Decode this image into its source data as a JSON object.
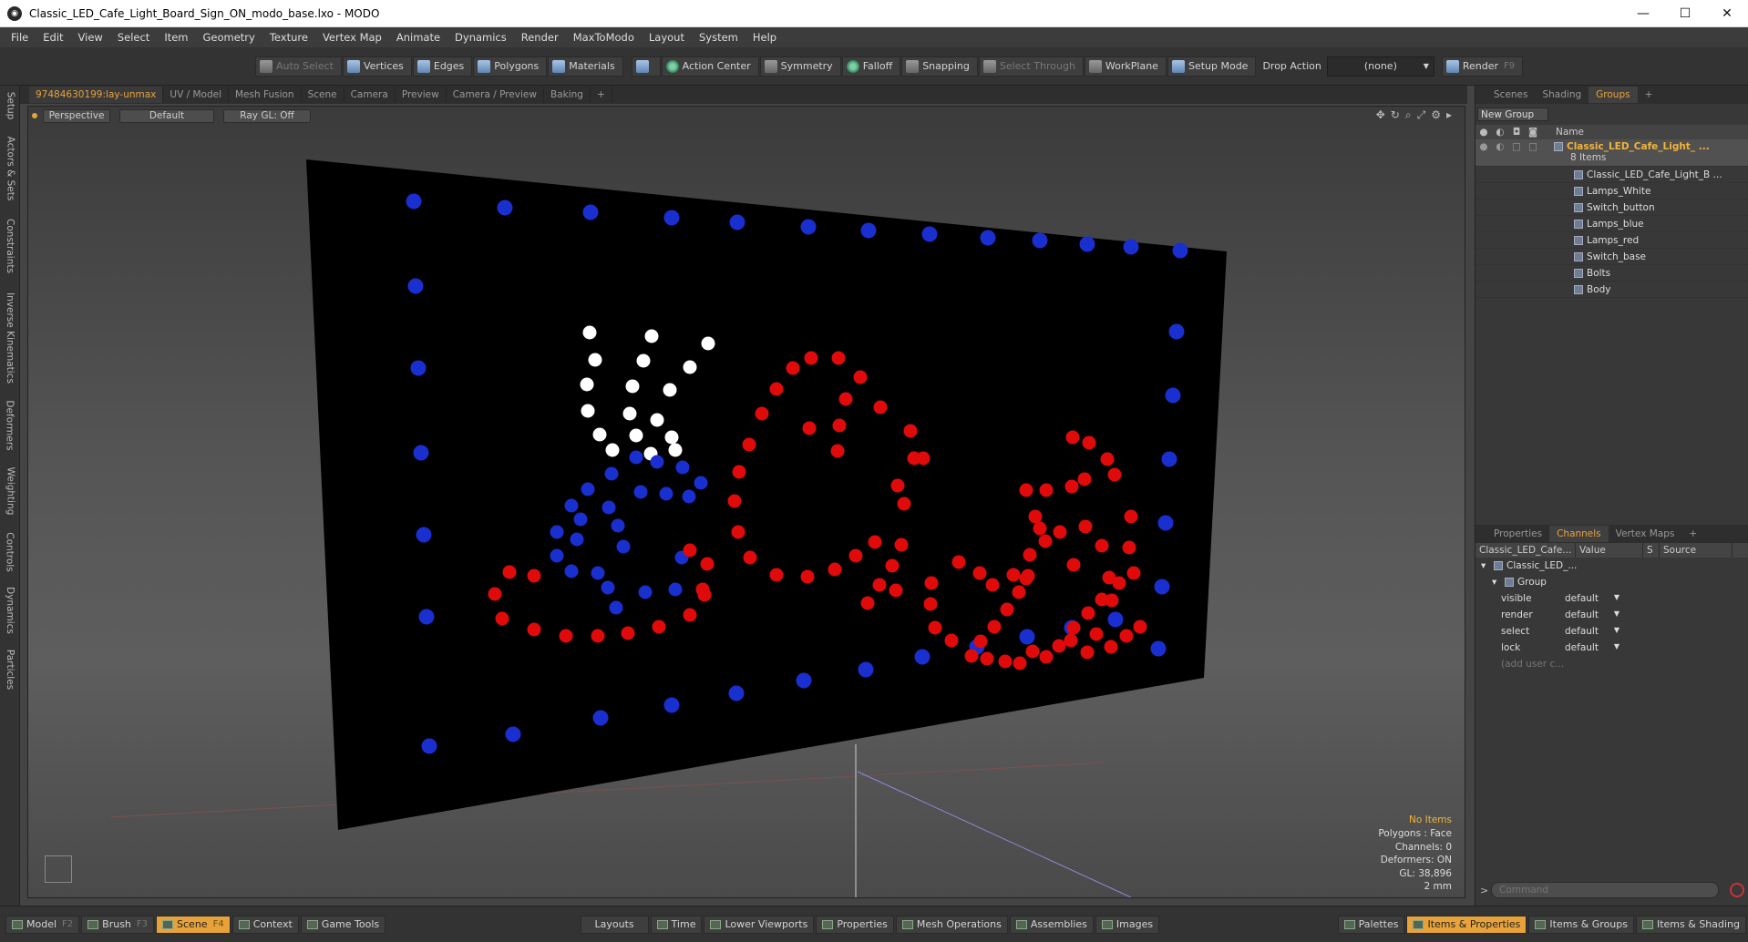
{
  "window": {
    "title": "Classic_LED_Cafe_Light_Board_Sign_ON_modo_base.lxo - MODO",
    "minimize": "—",
    "maximize": "☐",
    "close": "✕"
  },
  "menu": [
    "File",
    "Edit",
    "View",
    "Select",
    "Item",
    "Geometry",
    "Texture",
    "Vertex Map",
    "Animate",
    "Dynamics",
    "Render",
    "MaxToModo",
    "Layout",
    "System",
    "Help"
  ],
  "toolbar": {
    "auto_select": "Auto Select",
    "vertices": "Vertices",
    "edges": "Edges",
    "polygons": "Polygons",
    "materials": "Materials",
    "action_center": "Action Center",
    "symmetry": "Symmetry",
    "falloff": "Falloff",
    "snapping": "Snapping",
    "select_through": "Select Through",
    "workplane": "WorkPlane",
    "setup_mode": "Setup Mode",
    "drop_action_label": "Drop Action",
    "drop_action_value": "(none)",
    "render": "Render",
    "render_key": "F9"
  },
  "left_tabs": [
    "Setup",
    "Actors & Sets",
    "Constraints",
    "Inverse Kinematics",
    "Deformers",
    "Weighting",
    "Controls",
    "Dynamics",
    "Particles"
  ],
  "viewport_tabs": [
    "97484630199:lay-unmax",
    "UV / Model",
    "Mesh Fusion",
    "Scene",
    "Camera",
    "Preview",
    "Camera / Preview",
    "Baking",
    "+"
  ],
  "viewport": {
    "view_mode": "Perspective",
    "shading": "Default",
    "raygl": "Ray GL: Off",
    "sign_text": "Cafe",
    "info": {
      "selection": "No Items",
      "polygons": "Polygons : Face",
      "channels": "Channels: 0",
      "deformers": "Deformers: ON",
      "gl": "GL: 38,896",
      "scale": "2 mm"
    },
    "colors": {
      "board": "#000000",
      "border_led": "#1a2fd0",
      "red_led": "#e00a0a",
      "white_led": "#ffffff",
      "cup_led": "#1a2fd0"
    }
  },
  "right_top_tabs": [
    "Scenes",
    "Shading",
    "Groups",
    "+"
  ],
  "groups": {
    "new_group": "New Group",
    "col_name": "Name",
    "root": {
      "name": "Classic_LED_Cafe_Light_ ...",
      "count": "8 Items"
    },
    "items": [
      "Classic_LED_Cafe_Light_B ...",
      "Lamps_White",
      "Switch_button",
      "Lamps_blue",
      "Lamps_red",
      "Switch_base",
      "Bolts",
      "Body"
    ]
  },
  "right_bottom_tabs": [
    "Properties",
    "Channels",
    "Vertex Maps",
    "+"
  ],
  "channels": {
    "headers": [
      "Classic_LED_Cafe...",
      "Value",
      "S",
      "Source"
    ],
    "root": "Classic_LED_...",
    "group": "Group",
    "rows": [
      {
        "name": "visible",
        "value": "default"
      },
      {
        "name": "render",
        "value": "default"
      },
      {
        "name": "select",
        "value": "default"
      },
      {
        "name": "lock",
        "value": "default"
      }
    ],
    "add_user": "(add user c..."
  },
  "command": {
    "placeholder": "Command"
  },
  "bottom": {
    "model": "Model",
    "model_key": "F2",
    "brush": "Brush",
    "brush_key": "F3",
    "scene": "Scene",
    "scene_key": "F4",
    "context": "Context",
    "game_tools": "Game Tools",
    "layouts": "Layouts",
    "time": "Time",
    "lower_viewports": "Lower Viewports",
    "properties": "Properties",
    "mesh_operations": "Mesh Operations",
    "assemblies": "Assemblies",
    "images": "Images",
    "palettes": "Palettes",
    "items_properties": "Items & Properties",
    "items_groups": "Items & Groups",
    "items_shading": "Items & Shading"
  }
}
